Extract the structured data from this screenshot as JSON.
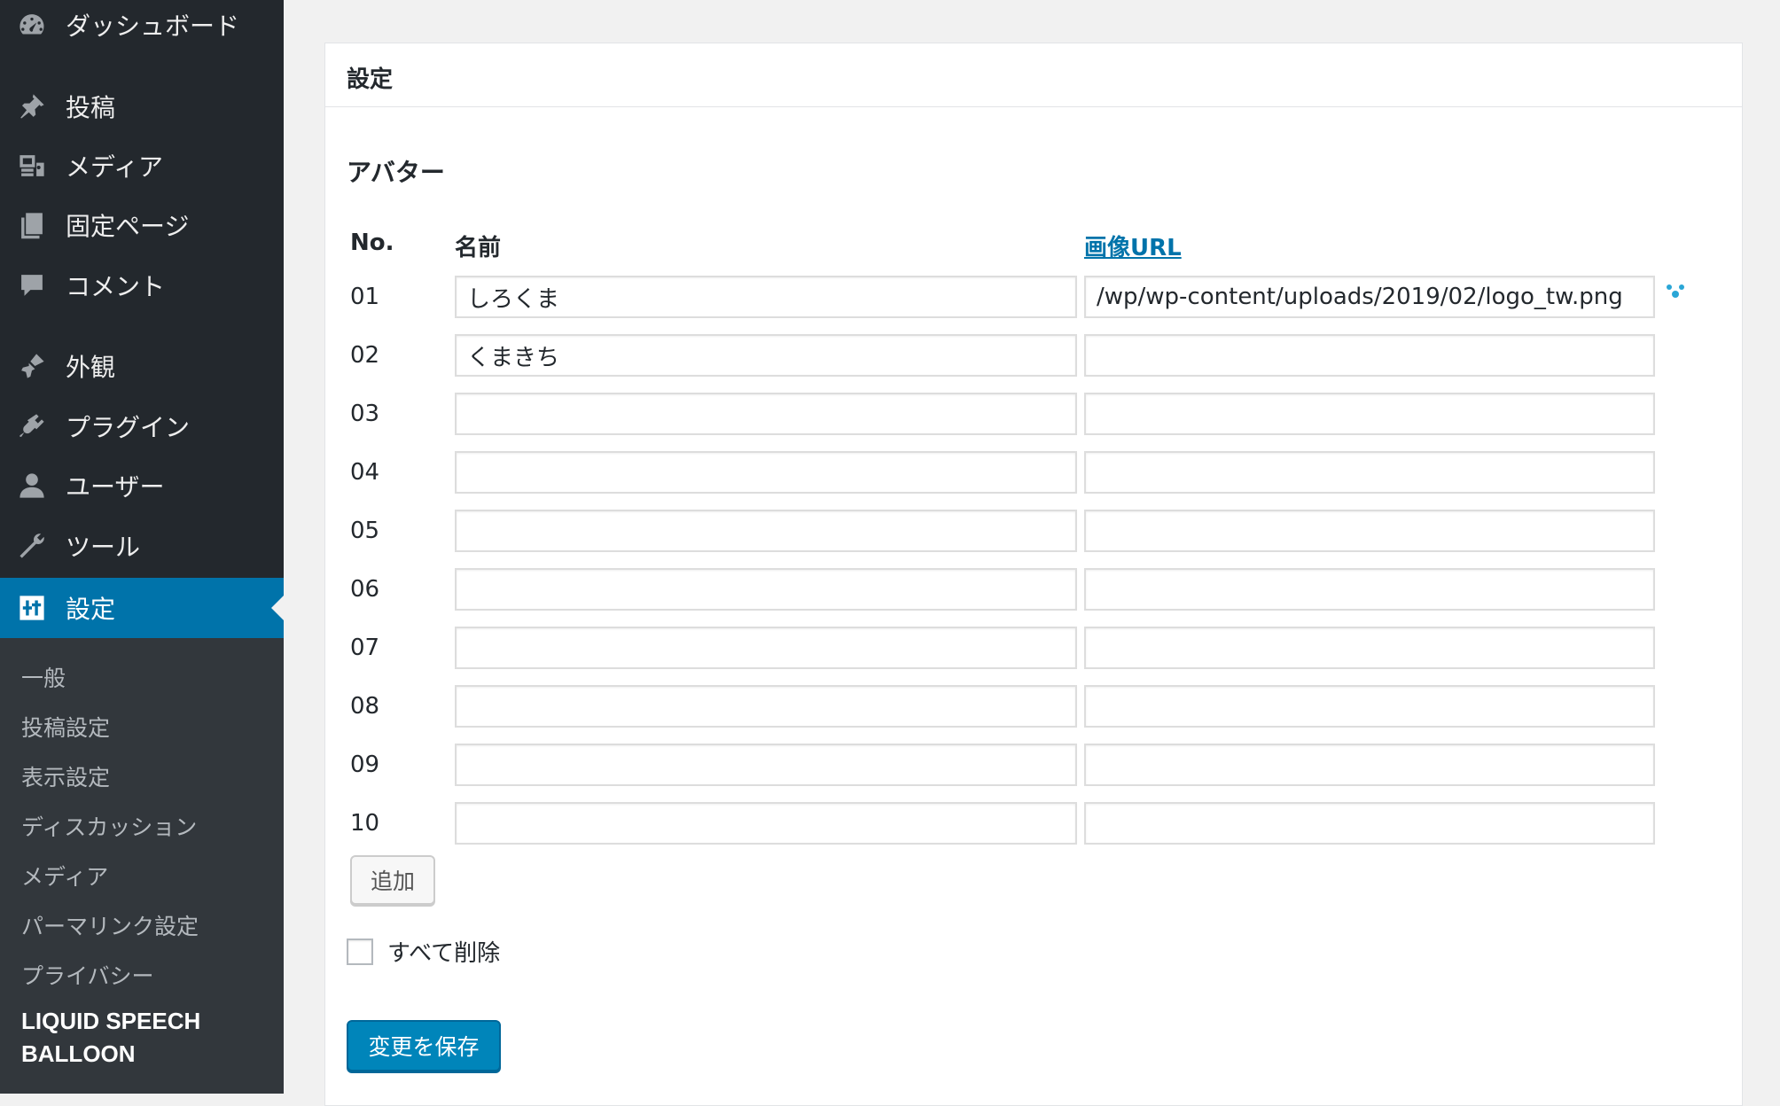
{
  "sidebar": {
    "items": [
      {
        "label": "ダッシュボード",
        "icon": "dashboard-icon"
      },
      {
        "label": "投稿",
        "icon": "pushpin-icon"
      },
      {
        "label": "メディア",
        "icon": "media-icon"
      },
      {
        "label": "固定ページ",
        "icon": "pages-icon"
      },
      {
        "label": "コメント",
        "icon": "comment-icon"
      },
      {
        "label": "外観",
        "icon": "paintbrush-icon"
      },
      {
        "label": "プラグイン",
        "icon": "plugin-icon"
      },
      {
        "label": "ユーザー",
        "icon": "user-icon"
      },
      {
        "label": "ツール",
        "icon": "wrench-icon"
      },
      {
        "label": "設定",
        "icon": "settings-icon",
        "current": true
      }
    ],
    "submenu": [
      "一般",
      "投稿設定",
      "表示設定",
      "ディスカッション",
      "メディア",
      "パーマリンク設定",
      "プライバシー",
      "LIQUID SPEECH BALLOON"
    ]
  },
  "panel": {
    "title": "設定",
    "section_title": "アバター",
    "columns": {
      "no": "No.",
      "name": "名前",
      "url": "画像URL"
    },
    "rows": [
      {
        "no": "01",
        "name": "しろくま",
        "url": "/wp/wp-content/uploads/2019/02/logo_tw.png"
      },
      {
        "no": "02",
        "name": "くまきち",
        "url": ""
      },
      {
        "no": "03",
        "name": "",
        "url": ""
      },
      {
        "no": "04",
        "name": "",
        "url": ""
      },
      {
        "no": "05",
        "name": "",
        "url": ""
      },
      {
        "no": "06",
        "name": "",
        "url": ""
      },
      {
        "no": "07",
        "name": "",
        "url": ""
      },
      {
        "no": "08",
        "name": "",
        "url": ""
      },
      {
        "no": "09",
        "name": "",
        "url": ""
      },
      {
        "no": "10",
        "name": "",
        "url": ""
      }
    ],
    "add_label": "追加",
    "delete_all_label": "すべて削除",
    "save_label": "変更を保存"
  },
  "colors": {
    "sidebar_bg": "#23282d",
    "submenu_bg": "#32373c",
    "accent": "#0073aa",
    "primary_button": "#0085ba"
  }
}
